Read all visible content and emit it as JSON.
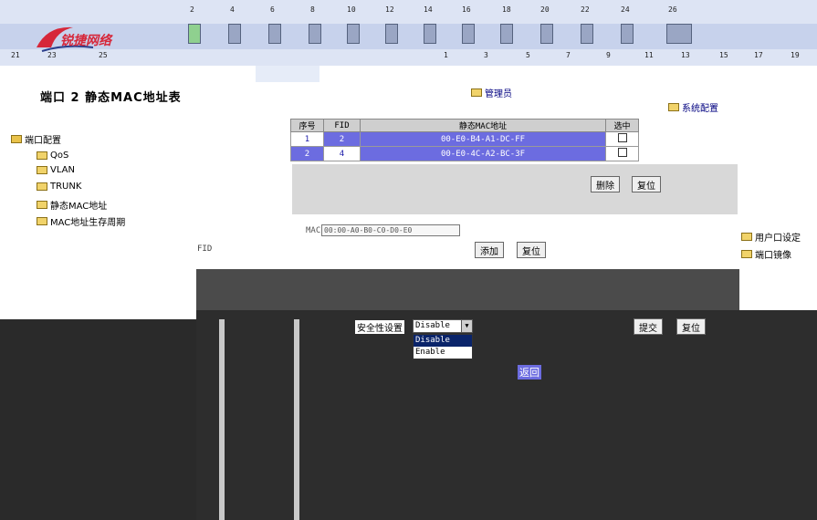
{
  "brand": {
    "logo_text": "锐捷网络",
    "accent": "#d6273a"
  },
  "header": {
    "top_port_numbers": [
      "2",
      "4",
      "6",
      "8",
      "10",
      "12",
      "14",
      "16",
      "18",
      "20",
      "22",
      "24",
      "26"
    ],
    "bottom_port_numbers_left": [
      "21",
      "23",
      "25"
    ],
    "bottom_port_numbers_mid": [
      "1",
      "3",
      "5",
      "7",
      "9",
      "11",
      "13"
    ],
    "bottom_port_numbers_right": [
      "15",
      "17",
      "19"
    ]
  },
  "page": {
    "title": "端口 2 静态MAC地址表"
  },
  "links": {
    "admin": "管理员",
    "system_config": "系统配置"
  },
  "tree": {
    "items": [
      {
        "label": "端口配置",
        "icon": "folder-icon"
      },
      {
        "label": "QoS",
        "icon": "folder-icon"
      },
      {
        "label": "VLAN",
        "icon": "folder-icon"
      },
      {
        "label": "TRUNK",
        "icon": "folder-icon"
      },
      {
        "label": "静态MAC地址",
        "icon": "folder-icon"
      },
      {
        "label": "MAC地址生存周期",
        "icon": "folder-icon"
      }
    ]
  },
  "mac_table": {
    "headers": [
      "序号",
      "FID",
      "静态MAC地址",
      "选中"
    ],
    "rows": [
      {
        "index": "1",
        "fid": "2",
        "mac": "00-E0-B4-A1-DC-FF"
      },
      {
        "index": "2",
        "fid": "4",
        "mac": "00-E0-4C-A2-BC-3F"
      }
    ]
  },
  "buttons": {
    "delete": "删除",
    "reset": "复位",
    "add": "添加",
    "reset2": "复位",
    "submit": "提交",
    "reset3": "复位"
  },
  "add_form": {
    "mac_prefix": "MAC",
    "mac_value": "00:00-A0-B0-C0-D0-E0",
    "fid_label": "FID"
  },
  "security": {
    "label": "安全性设置",
    "selected": "Disable",
    "options": [
      "Disable",
      "Enable"
    ]
  },
  "return_link": "返回",
  "right_menu": {
    "items": [
      "用户口设定",
      "端口镜像"
    ]
  },
  "colors": {
    "banner": "#dde4f4",
    "highlight": "#6c6ce0",
    "dark": "#2d2d2d"
  }
}
